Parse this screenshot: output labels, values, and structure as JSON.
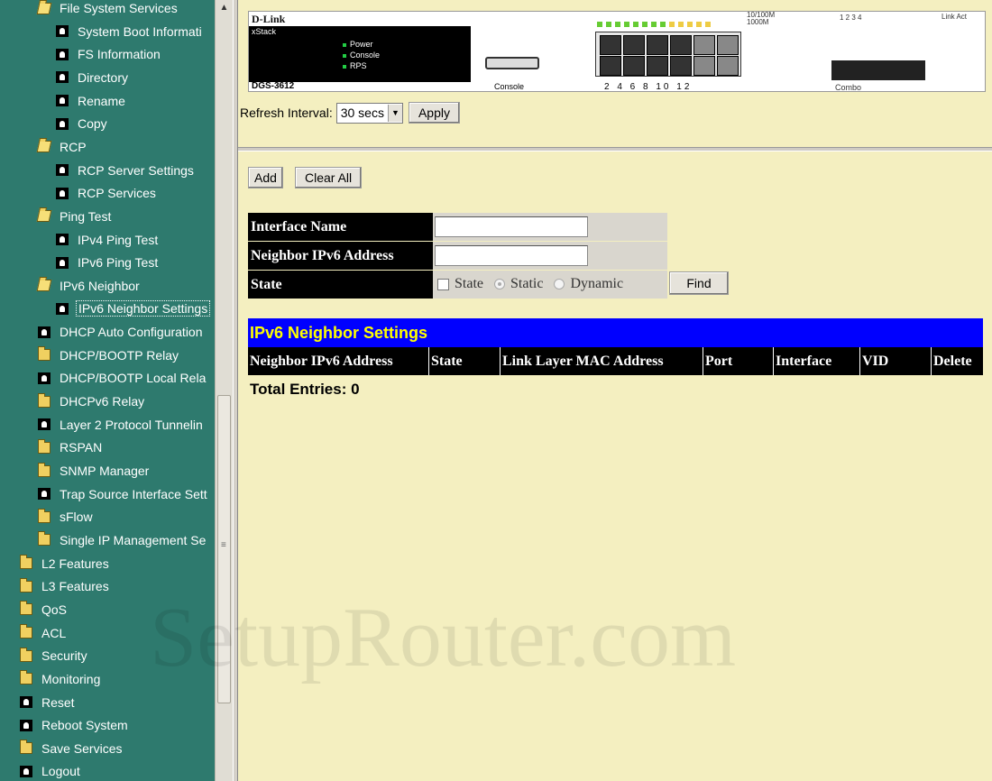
{
  "sidebar": {
    "items": [
      {
        "label": "File System Services",
        "icon": "folder-open-icon",
        "level": 1
      },
      {
        "label": "System Boot Informati",
        "icon": "page-icon",
        "level": 2
      },
      {
        "label": "FS Information",
        "icon": "page-icon",
        "level": 2
      },
      {
        "label": "Directory",
        "icon": "page-icon",
        "level": 2
      },
      {
        "label": "Rename",
        "icon": "page-icon",
        "level": 2
      },
      {
        "label": "Copy",
        "icon": "page-icon",
        "level": 2
      },
      {
        "label": "RCP",
        "icon": "folder-open-icon",
        "level": 1
      },
      {
        "label": "RCP Server Settings",
        "icon": "page-icon",
        "level": 2
      },
      {
        "label": "RCP Services",
        "icon": "page-icon",
        "level": 2
      },
      {
        "label": "Ping Test",
        "icon": "folder-open-icon",
        "level": 1
      },
      {
        "label": "IPv4 Ping Test",
        "icon": "page-icon",
        "level": 2
      },
      {
        "label": "IPv6 Ping Test",
        "icon": "page-icon",
        "level": 2
      },
      {
        "label": "IPv6 Neighbor",
        "icon": "folder-open-icon",
        "level": 1
      },
      {
        "label": "IPv6 Neighbor Settings",
        "icon": "page-icon",
        "level": 2,
        "selected": true
      },
      {
        "label": "DHCP Auto Configuration",
        "icon": "page-icon",
        "level": 1
      },
      {
        "label": "DHCP/BOOTP Relay",
        "icon": "folder-icon",
        "level": 1
      },
      {
        "label": "DHCP/BOOTP Local Rela",
        "icon": "page-icon",
        "level": 1
      },
      {
        "label": "DHCPv6 Relay",
        "icon": "folder-icon",
        "level": 1
      },
      {
        "label": "Layer 2 Protocol Tunnelin",
        "icon": "page-icon",
        "level": 1
      },
      {
        "label": "RSPAN",
        "icon": "folder-icon",
        "level": 1
      },
      {
        "label": "SNMP Manager",
        "icon": "folder-icon",
        "level": 1
      },
      {
        "label": "Trap Source Interface Sett",
        "icon": "page-icon",
        "level": 1
      },
      {
        "label": "sFlow",
        "icon": "folder-icon",
        "level": 1
      },
      {
        "label": "Single IP Management Se",
        "icon": "folder-icon",
        "level": 1
      },
      {
        "label": "L2 Features",
        "icon": "folder-icon",
        "level": 0
      },
      {
        "label": "L3 Features",
        "icon": "folder-icon",
        "level": 0
      },
      {
        "label": "QoS",
        "icon": "folder-icon",
        "level": 0
      },
      {
        "label": "ACL",
        "icon": "folder-icon",
        "level": 0
      },
      {
        "label": "Security",
        "icon": "folder-icon",
        "level": 0
      },
      {
        "label": "Monitoring",
        "icon": "folder-icon",
        "level": 0
      },
      {
        "label": "Reset",
        "icon": "page-icon",
        "level": 0
      },
      {
        "label": "Reboot System",
        "icon": "page-icon",
        "level": 0
      },
      {
        "label": "Save Services",
        "icon": "folder-icon",
        "level": 0
      },
      {
        "label": "Logout",
        "icon": "page-icon",
        "level": 0
      }
    ]
  },
  "device": {
    "brand": "D-Link",
    "stack": "xStack",
    "leds": [
      "Power",
      "Console",
      "RPS"
    ],
    "model": "DGS-3612",
    "console_label": "Console",
    "speed_label_1": "10/100M",
    "speed_label_2": "1000M",
    "port_numbers": "2 4 6 8 10 12",
    "combo_ports": "1 2 3 4",
    "link_label": "Link",
    "act_label": "Act",
    "combo_label": "Combo"
  },
  "refresh": {
    "label": "Refresh Interval:",
    "value": "30 secs",
    "apply_label": "Apply"
  },
  "form": {
    "add_label": "Add",
    "clear_all_label": "Clear All",
    "interface_name_label": "Interface Name",
    "interface_name_value": "",
    "neighbor_ipv6_label": "Neighbor IPv6 Address",
    "neighbor_ipv6_value": "",
    "state_label": "State",
    "state_option": "State",
    "static_option": "Static",
    "dynamic_option": "Dynamic",
    "find_label": "Find"
  },
  "table": {
    "title": "IPv6 Neighbor Settings",
    "columns": [
      "Neighbor IPv6 Address",
      "State",
      "Link Layer MAC Address",
      "Port",
      "Interface",
      "VID",
      "Delete"
    ],
    "total_entries": "Total Entries: 0"
  },
  "watermark": "SetupRouter.com"
}
